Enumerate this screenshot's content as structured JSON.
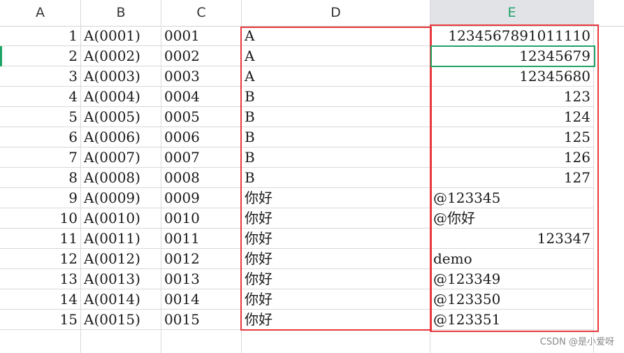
{
  "columns": [
    {
      "id": "A",
      "label": "A"
    },
    {
      "id": "B",
      "label": "B"
    },
    {
      "id": "C",
      "label": "C"
    },
    {
      "id": "D",
      "label": "D"
    },
    {
      "id": "E",
      "label": "E",
      "selected": true
    }
  ],
  "rows": [
    {
      "a": "1",
      "b": "A(0001)",
      "c": "0001",
      "d": "A",
      "e": "1234567891011110",
      "e_align": "right"
    },
    {
      "a": "2",
      "b": "A(0002)",
      "c": "0002",
      "d": "A",
      "e": "12345679",
      "e_align": "right"
    },
    {
      "a": "3",
      "b": "A(0003)",
      "c": "0003",
      "d": "A",
      "e": "12345680",
      "e_align": "right"
    },
    {
      "a": "4",
      "b": "A(0004)",
      "c": "0004",
      "d": "B",
      "e": "123",
      "e_align": "right"
    },
    {
      "a": "5",
      "b": "A(0005)",
      "c": "0005",
      "d": "B",
      "e": "124",
      "e_align": "right"
    },
    {
      "a": "6",
      "b": "A(0006)",
      "c": "0006",
      "d": "B",
      "e": "125",
      "e_align": "right"
    },
    {
      "a": "7",
      "b": "A(0007)",
      "c": "0007",
      "d": "B",
      "e": "126",
      "e_align": "right"
    },
    {
      "a": "8",
      "b": "A(0008)",
      "c": "0008",
      "d": "B",
      "e": "127",
      "e_align": "right"
    },
    {
      "a": "9",
      "b": "A(0009)",
      "c": "0009",
      "d": "你好",
      "e": "@123345",
      "e_align": "left"
    },
    {
      "a": "10",
      "b": "A(0010)",
      "c": "0010",
      "d": "你好",
      "e": "@你好",
      "e_align": "left"
    },
    {
      "a": "11",
      "b": "A(0011)",
      "c": "0011",
      "d": "你好",
      "e": "123347",
      "e_align": "right"
    },
    {
      "a": "12",
      "b": "A(0012)",
      "c": "0012",
      "d": "你好",
      "e": "demo",
      "e_align": "left"
    },
    {
      "a": "13",
      "b": "A(0013)",
      "c": "0013",
      "d": "你好",
      "e": "@123349",
      "e_align": "left"
    },
    {
      "a": "14",
      "b": "A(0014)",
      "c": "0014",
      "d": "你好",
      "e": "@123350",
      "e_align": "left"
    },
    {
      "a": "15",
      "b": "A(0015)",
      "c": "0015",
      "d": "你好",
      "e": "@123351",
      "e_align": "left"
    }
  ],
  "active_cell": "E2",
  "highlight_color": "#e8383d",
  "selection_color": "#21a366",
  "watermark": "CSDN @是小爱呀"
}
